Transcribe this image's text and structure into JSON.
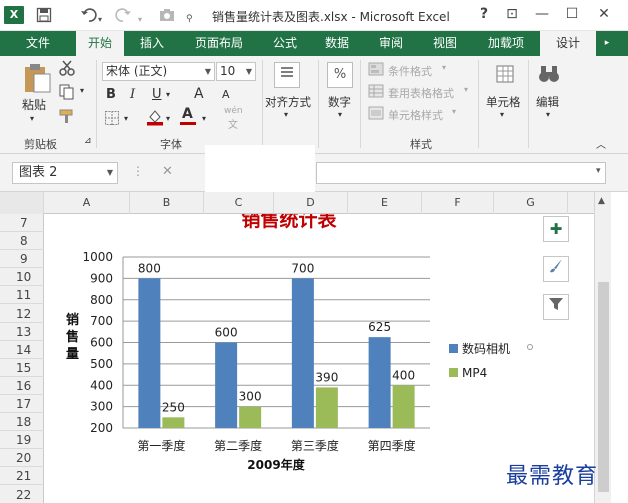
{
  "window": {
    "app_icon": "X",
    "title": "销售量统计表及图表.xlsx - Microsoft Excel",
    "controls": {
      "help": "?",
      "restore_ribbon": "⊡",
      "minimize": "—",
      "maximize": "☐",
      "close": "✕"
    }
  },
  "qat": {
    "save_icon": "save-icon",
    "undo_icon": "undo-icon",
    "redo_icon": "redo-icon",
    "camera_icon": "camera-icon"
  },
  "tabs": [
    {
      "label": "文件"
    },
    {
      "label": "开始"
    },
    {
      "label": "插入"
    },
    {
      "label": "页面布局"
    },
    {
      "label": "公式"
    },
    {
      "label": "数据"
    },
    {
      "label": "审阅"
    },
    {
      "label": "视图"
    },
    {
      "label": "加载项"
    },
    {
      "label": "设计"
    }
  ],
  "ribbon": {
    "clipboard": {
      "label": "剪贴板",
      "paste": "粘贴"
    },
    "font": {
      "label": "字体",
      "name": "宋体 (正文)",
      "size": "10",
      "bold": "B",
      "italic": "I",
      "underline": "U",
      "grow": "A",
      "shrink": "A",
      "font_color": "A",
      "wen": "wén",
      "wen2": "文"
    },
    "alignment": {
      "label": "对齐方式"
    },
    "number": {
      "label": "数字",
      "icon": "%"
    },
    "styles": {
      "label": "样式",
      "conditional": "条件格式",
      "table": "套用表格格式",
      "cell": "单元格样式"
    },
    "cells": {
      "label": "单元格"
    },
    "editing": {
      "label": "编辑"
    }
  },
  "formula_bar": {
    "name_box": "图表 2",
    "cancel": "✕"
  },
  "columns": [
    "A",
    "B",
    "C",
    "D",
    "E",
    "F",
    "G"
  ],
  "rows": [
    "7",
    "8",
    "9",
    "10",
    "11",
    "12",
    "13",
    "14",
    "15",
    "16",
    "17",
    "18",
    "19",
    "20",
    "21",
    "22"
  ],
  "chart_data": {
    "type": "bar",
    "title": "销售统计表",
    "xlabel": "2009年度",
    "ylabel": "销售量",
    "categories": [
      "第一季度",
      "第二季度",
      "第三季度",
      "第四季度"
    ],
    "series": [
      {
        "name": "数码相机",
        "values": [
          800,
          600,
          700,
          625
        ],
        "color": "#4f81bd"
      },
      {
        "name": "MP4",
        "values": [
          250,
          300,
          390,
          400
        ],
        "color": "#9bbb59"
      }
    ],
    "bar_heights_shown": [
      [
        900,
        600,
        900,
        625
      ],
      [
        250,
        300,
        390,
        400
      ]
    ],
    "ylim": [
      200,
      1000
    ],
    "yticks": [
      200,
      300,
      400,
      500,
      600,
      700,
      800,
      900,
      1000
    ],
    "grid": true,
    "legend": "right"
  },
  "chart_tools": {
    "add_element_icon": "plus-icon",
    "style_icon": "brush-icon",
    "filter_icon": "filter-icon"
  },
  "watermark": "最需教育",
  "colors": {
    "excel_green": "#217346",
    "title_red": "#c00000"
  }
}
